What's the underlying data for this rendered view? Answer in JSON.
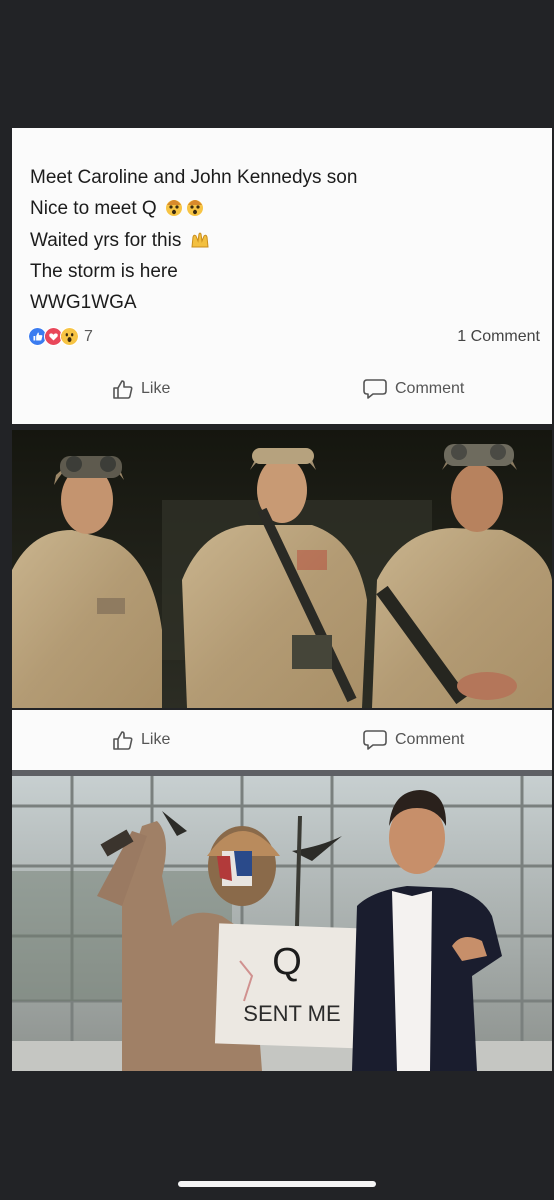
{
  "post": {
    "lines": [
      "Meet Caroline and John Kennedys son",
      "Nice to meet Q",
      "Waited yrs for this",
      "The storm is here",
      "WWG1WGA"
    ],
    "reaction_count": "7",
    "comment_count": "1 Comment"
  },
  "actions": {
    "like_label": "Like",
    "comment_label": "Comment"
  },
  "photo2": {
    "sign_q": "Q",
    "sign_text": "SENT ME"
  },
  "colors": {
    "background": "#222326",
    "card": "#fbfbfb",
    "like_blue": "#3b7cf0",
    "love_red": "#e9475a",
    "wow_yellow": "#f7c444"
  },
  "icons": [
    "thumbs-up-icon",
    "comment-bubble-icon",
    "like-reaction-icon",
    "love-reaction-icon",
    "wow-reaction-icon",
    "shocked-face-emoji-icon",
    "raising-hands-emoji-icon"
  ]
}
